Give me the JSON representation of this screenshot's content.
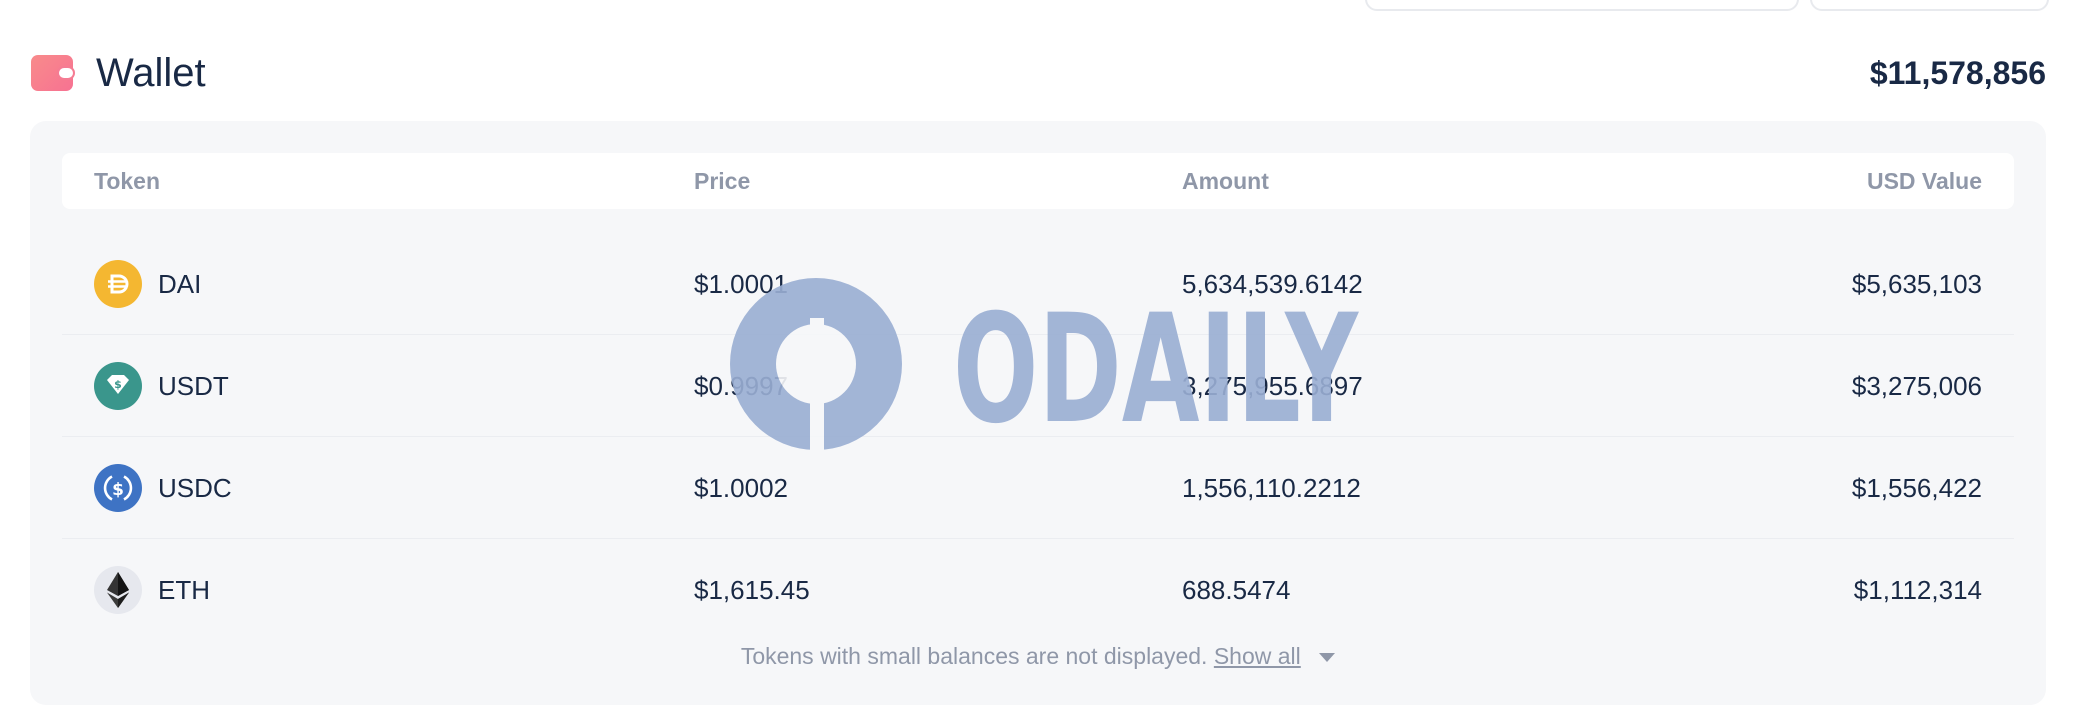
{
  "wallet": {
    "icon": "wallet-icon",
    "title": "Wallet",
    "total": "$11,578,856"
  },
  "table": {
    "headers": {
      "token": "Token",
      "price": "Price",
      "amount": "Amount",
      "usd_value": "USD Value"
    },
    "rows": [
      {
        "token": "DAI",
        "icon": "dai-icon",
        "price": "$1.0001",
        "amount": "5,634,539.6142",
        "usd_value": "$5,635,103"
      },
      {
        "token": "USDT",
        "icon": "usdt-icon",
        "price": "$0.9997",
        "amount": "3,275,955.6897",
        "usd_value": "$3,275,006"
      },
      {
        "token": "USDC",
        "icon": "usdc-icon",
        "price": "$1.0002",
        "amount": "1,556,110.2212",
        "usd_value": "$1,556,422"
      },
      {
        "token": "ETH",
        "icon": "eth-icon",
        "price": "$1,615.45",
        "amount": "688.5474",
        "usd_value": "$1,112,314"
      }
    ]
  },
  "footer": {
    "note": "Tokens with small balances are not displayed.",
    "show_all": "Show all"
  },
  "watermark": {
    "text": "ODAILY",
    "color": "#9aaed3"
  },
  "colors": {
    "text": "#192945",
    "muted": "#8f97a8",
    "panel": "#f6f7f9",
    "dai": "#f4b731",
    "usdt": "#3a968c",
    "usdc": "#3e73c4",
    "eth_bg": "#e6e8ee"
  }
}
